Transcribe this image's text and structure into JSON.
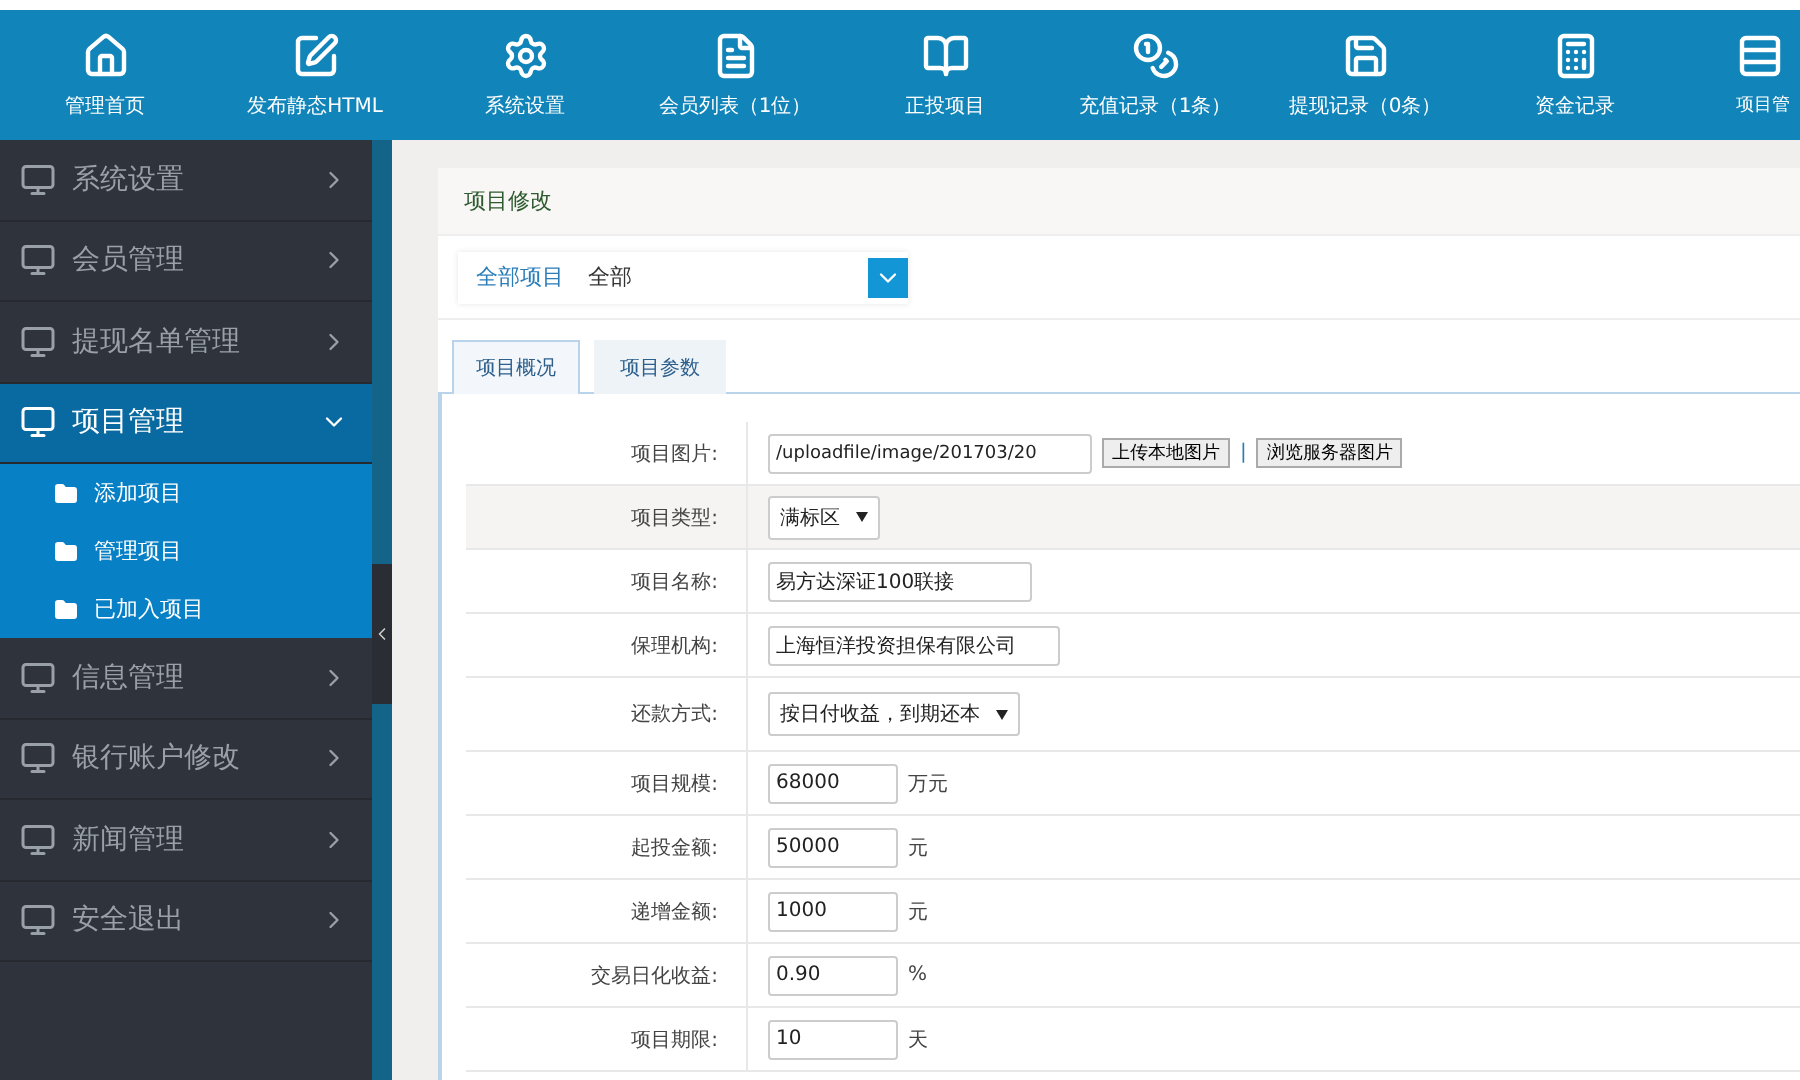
{
  "top_nav": [
    {
      "label": "管理首页"
    },
    {
      "label": "发布静态HTML"
    },
    {
      "label": "系统设置"
    },
    {
      "label": "会员列表（1位）"
    },
    {
      "label": "正投项目"
    },
    {
      "label": "充值记录（1条）"
    },
    {
      "label": "提现记录（0条）"
    },
    {
      "label": "资金记录"
    },
    {
      "label": "项目管"
    }
  ],
  "sidebar": {
    "items": [
      {
        "label": "系统设置",
        "expanded": false
      },
      {
        "label": "会员管理",
        "expanded": false
      },
      {
        "label": "提现名单管理",
        "expanded": false
      },
      {
        "label": "项目管理",
        "expanded": true,
        "children": [
          {
            "label": "添加项目"
          },
          {
            "label": "管理项目"
          },
          {
            "label": "已加入项目"
          }
        ]
      },
      {
        "label": "信息管理",
        "expanded": false
      },
      {
        "label": "银行账户修改",
        "expanded": false
      },
      {
        "label": "新闻管理",
        "expanded": false
      },
      {
        "label": "安全退出",
        "expanded": false
      }
    ]
  },
  "panel": {
    "title": "项目修改",
    "filter": {
      "label": "全部项目",
      "value": "全部"
    },
    "tabs": [
      {
        "label": "项目概况",
        "selected": true
      },
      {
        "label": "项目参数",
        "selected": false
      }
    ],
    "form": [
      {
        "kind": "upload",
        "label": "项目图片:",
        "value": "/uploadfile/image/201703/20",
        "buttons": [
          "上传本地图片",
          "浏览服务器图片"
        ],
        "separator": "|"
      },
      {
        "kind": "select",
        "label": "项目类型:",
        "value": "满标区"
      },
      {
        "kind": "text",
        "label": "项目名称:",
        "value": "易方达深证100联接"
      },
      {
        "kind": "text",
        "label": "保理机构:",
        "value": "上海恒洋投资担保有限公司"
      },
      {
        "kind": "select",
        "label": "还款方式:",
        "value": "按日付收益，到期还本"
      },
      {
        "kind": "text",
        "label": "项目规模:",
        "value": "68000",
        "unit": "万元"
      },
      {
        "kind": "text",
        "label": "起投金额:",
        "value": "50000",
        "unit": "元"
      },
      {
        "kind": "text",
        "label": "递增金额:",
        "value": "1000",
        "unit": "元"
      },
      {
        "kind": "text",
        "label": "交易日化收益:",
        "value": "0.90",
        "unit": "%"
      },
      {
        "kind": "text",
        "label": "项目期限:",
        "value": "10",
        "unit": "天"
      }
    ]
  }
}
